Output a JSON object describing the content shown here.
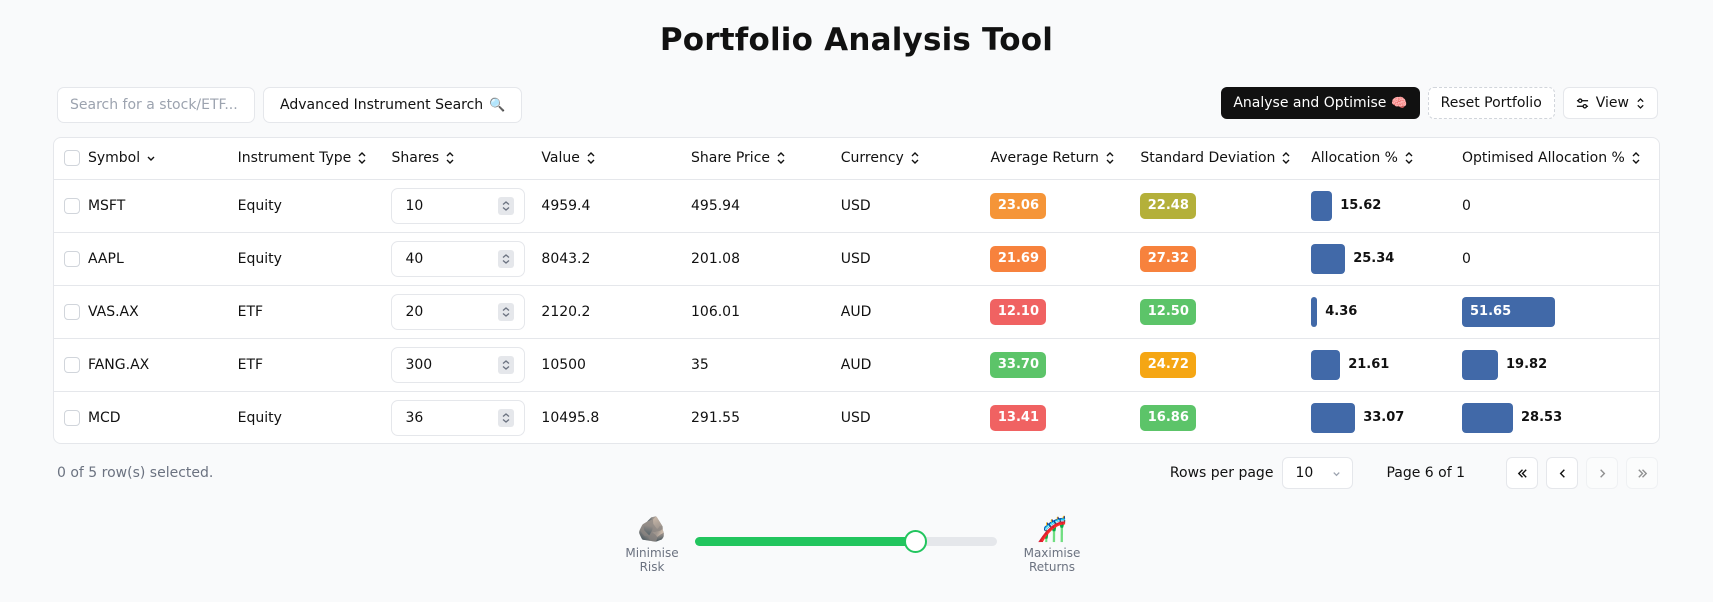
{
  "title": "Portfolio Analysis Tool",
  "search": {
    "placeholder": "Search for a stock/ETF..."
  },
  "toolbar": {
    "advanced_search_label": "Advanced Instrument Search",
    "advanced_search_icon": "🔍",
    "analyse_label": "Analyse and Optimise",
    "analyse_icon": "🧠",
    "reset_label": "Reset Portfolio",
    "view_label": "View"
  },
  "columns": [
    "Symbol",
    "Instrument Type",
    "Shares",
    "Value",
    "Share Price",
    "Currency",
    "Average Return",
    "Standard Deviation",
    "Allocation %",
    "Optimised Allocation %"
  ],
  "rows": [
    {
      "symbol": "MSFT",
      "type": "Equity",
      "shares": "10",
      "value": "4959.4",
      "price": "495.94",
      "currency": "USD",
      "avg_return": "23.06",
      "avg_return_color": "#f59538",
      "std_dev": "22.48",
      "std_dev_color": "#b4b03a",
      "allocation": "15.62",
      "allocation_fraction": 0.1562,
      "optimised": "0",
      "optimised_fraction": 0
    },
    {
      "symbol": "AAPL",
      "type": "Equity",
      "shares": "40",
      "value": "8043.2",
      "price": "201.08",
      "currency": "USD",
      "avg_return": "21.69",
      "avg_return_color": "#f7823d",
      "std_dev": "27.32",
      "std_dev_color": "#f7823d",
      "allocation": "25.34",
      "allocation_fraction": 0.2534,
      "optimised": "0",
      "optimised_fraction": 0
    },
    {
      "symbol": "VAS.AX",
      "type": "ETF",
      "shares": "20",
      "value": "2120.2",
      "price": "106.01",
      "currency": "AUD",
      "avg_return": "12.10",
      "avg_return_color": "#f06262",
      "std_dev": "12.50",
      "std_dev_color": "#5cc469",
      "allocation": "4.36",
      "allocation_fraction": 0.0436,
      "optimised": "51.65",
      "optimised_fraction": 0.5165
    },
    {
      "symbol": "FANG.AX",
      "type": "ETF",
      "shares": "300",
      "value": "10500",
      "price": "35",
      "currency": "AUD",
      "avg_return": "33.70",
      "avg_return_color": "#5cc469",
      "std_dev": "24.72",
      "std_dev_color": "#f5a614",
      "allocation": "21.61",
      "allocation_fraction": 0.2161,
      "optimised": "19.82",
      "optimised_fraction": 0.1982
    },
    {
      "symbol": "MCD",
      "type": "Equity",
      "shares": "36",
      "value": "10495.8",
      "price": "291.55",
      "currency": "USD",
      "avg_return": "13.41",
      "avg_return_color": "#f06262",
      "std_dev": "16.86",
      "std_dev_color": "#5cc469",
      "allocation": "33.07",
      "allocation_fraction": 0.3307,
      "optimised": "28.53",
      "optimised_fraction": 0.2853
    }
  ],
  "footer": {
    "selected_text": "0 of 5 row(s) selected.",
    "rows_per_page_label": "Rows per page",
    "rows_per_page_value": "10",
    "page_text": "Page 6 of 1"
  },
  "risk_slider": {
    "left_icon": "🪨",
    "left_label": "Minimise Risk",
    "right_icon": "🎢",
    "right_label": "Maximise Returns",
    "value_fraction": 0.73
  },
  "colors": {
    "accent": "#22c55e",
    "allocation_bar": "#4169a8",
    "primary_button": "#111111"
  }
}
